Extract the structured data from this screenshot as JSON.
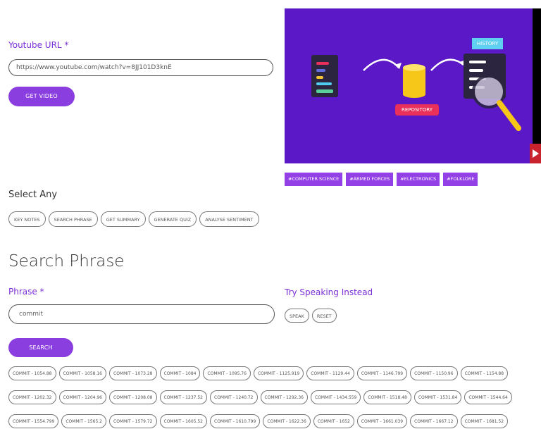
{
  "video_form": {
    "url_label": "Youtube URL *",
    "url_value": "https://www.youtube.com/watch?v=8JJ101D3knE",
    "get_video_label": "GET VIDEO"
  },
  "video": {
    "history_label": "HISTORY",
    "repository_label": "REPOSITORY"
  },
  "tags": [
    "#COMPUTER SCIENCE",
    "#ARMED FORCES",
    "#ELECTRONICS",
    "#FOLKLORE"
  ],
  "select_any": {
    "label": "Select Any",
    "options": [
      "KEY NOTES",
      "SEARCH PHRASE",
      "GET SUMMARY",
      "GENERATE QUIZ",
      "ANALYSE SENTIMENT"
    ]
  },
  "search_phrase": {
    "heading": "Search Phrase",
    "phrase_label": "Phrase *",
    "phrase_value": "commit",
    "search_label": "SEARCH",
    "speak_heading": "Try Speaking Instead",
    "speak_label": "SPEAK",
    "reset_label": "RESET"
  },
  "results": {
    "row1": [
      "COMMIT - 1054.88",
      "COMMIT - 1058.16",
      "COMMIT - 1073.28",
      "COMMIT - 1084",
      "COMMIT - 1095.76",
      "COMMIT - 1125.919",
      "COMMIT - 1129.44",
      "COMMIT - 1146.799",
      "COMMIT - 1150.96",
      "COMMIT - 1154.88"
    ],
    "row2": [
      "COMMIT - 1202.32",
      "COMMIT - 1204.96",
      "COMMIT - 1208.08",
      "COMMIT - 1237.52",
      "COMMIT - 1240.72",
      "COMMIT - 1292.36",
      "COMMIT - 1434.559",
      "COMMIT - 1518.48",
      "COMMIT - 1531.84",
      "COMMIT - 1544.64"
    ],
    "row3": [
      "COMMIT - 1554.799",
      "COMMIT - 1565.2",
      "COMMIT - 1579.72",
      "COMMIT - 1605.52",
      "COMMIT - 1610.799",
      "COMMIT - 1622.36",
      "COMMIT - 1652",
      "COMMIT - 1661.039",
      "COMMIT - 1667.12",
      "COMMIT - 1681.52"
    ]
  },
  "colors": {
    "accent": "#8a3ee0",
    "label_purple": "#7b2fd6",
    "video_bg": "#5a18c6",
    "history_badge": "#5fd0f0",
    "repository_badge": "#e8305a"
  }
}
